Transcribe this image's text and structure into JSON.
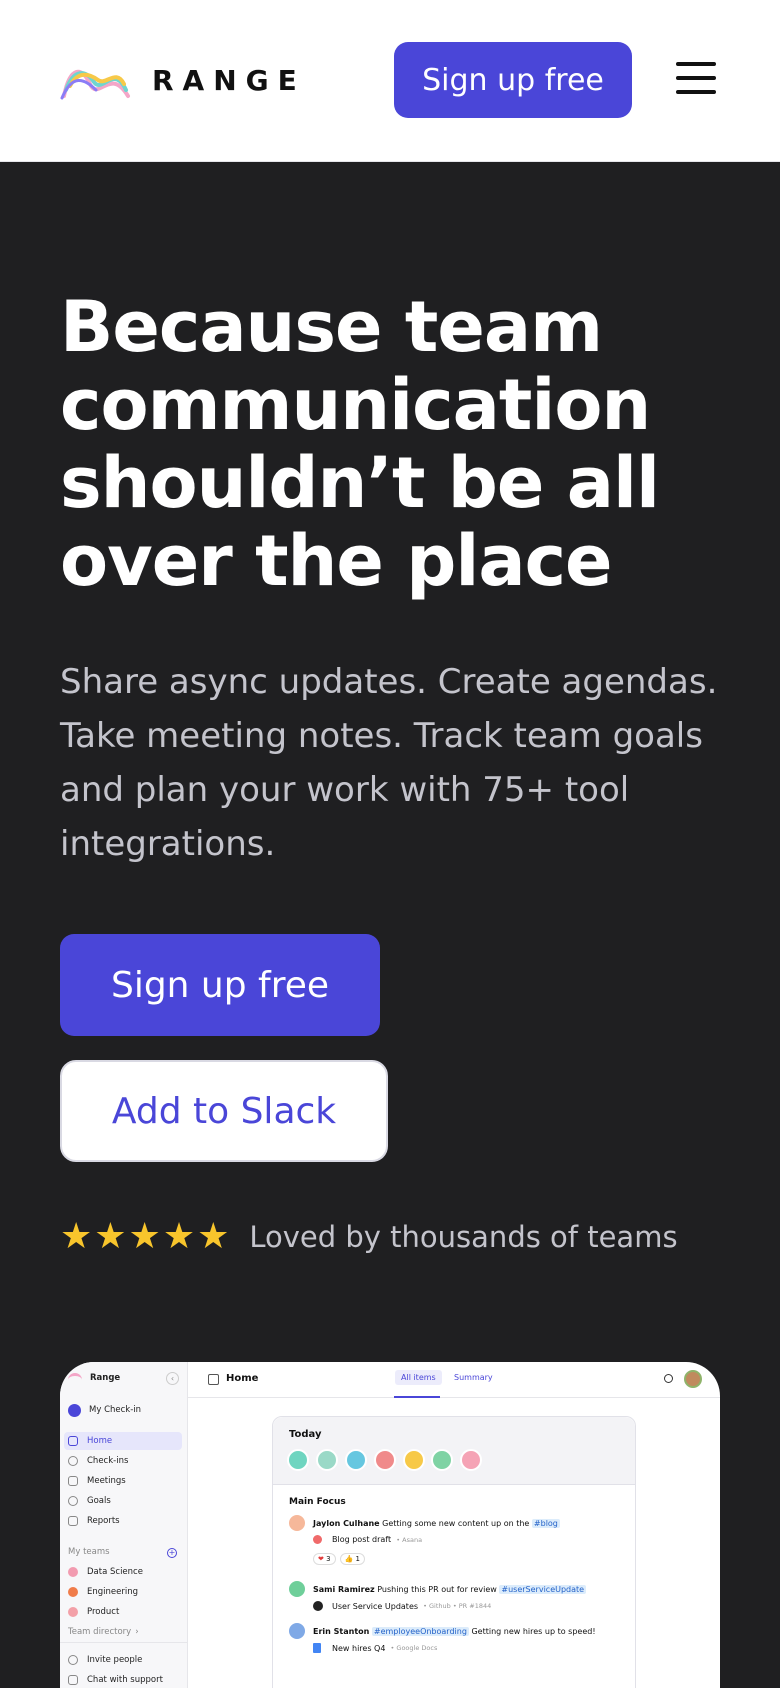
{
  "header": {
    "logo_text": "RANGE",
    "signup_label": "Sign up free"
  },
  "hero": {
    "title": "Because team communication shouldn’t be all over the place",
    "subtitle": "Share async updates. Create agendas. Take meeting notes. Track team goals and plan your work with 75+ tool integrations.",
    "primary_cta": "Sign up free",
    "secondary_cta": "Add to Slack",
    "stars": "★★★★★",
    "rating_text": "Loved by thousands of teams"
  },
  "app_preview": {
    "workspace": "Range",
    "my_checkin": "My Check-in",
    "nav": [
      "Home",
      "Check-ins",
      "Meetings",
      "Goals",
      "Reports"
    ],
    "teams_heading": "My teams",
    "teams": [
      "Data Science",
      "Engineering",
      "Product"
    ],
    "team_directory": "Team directory",
    "footer_links": [
      "Invite people",
      "Chat with support"
    ],
    "page_title": "Home",
    "tabs": [
      "All items",
      "Summary"
    ],
    "today_label": "Today",
    "main_focus_label": "Main Focus",
    "entries": [
      {
        "name": "Jaylon Culhane",
        "text": "Getting some new content up on the",
        "tag": "#blog",
        "sub_item": "Blog post draft",
        "sub_source": "• Asana",
        "reactions": [
          "3",
          "1"
        ]
      },
      {
        "name": "Sami Ramirez",
        "text": "Pushing this PR out for review",
        "tag": "#userServiceUpdate",
        "sub_item": "User Service Updates",
        "sub_source": "• Github • PR #1844"
      },
      {
        "name": "Erin Stanton",
        "tag": "#employeeOnboarding",
        "text": "Getting new hires up to speed!",
        "sub_item": "New hires Q4",
        "sub_source": "• Google Docs"
      }
    ]
  },
  "colors": {
    "accent": "#4a46d8",
    "hero_bg": "#1f1f21",
    "star": "#f8c52c"
  }
}
